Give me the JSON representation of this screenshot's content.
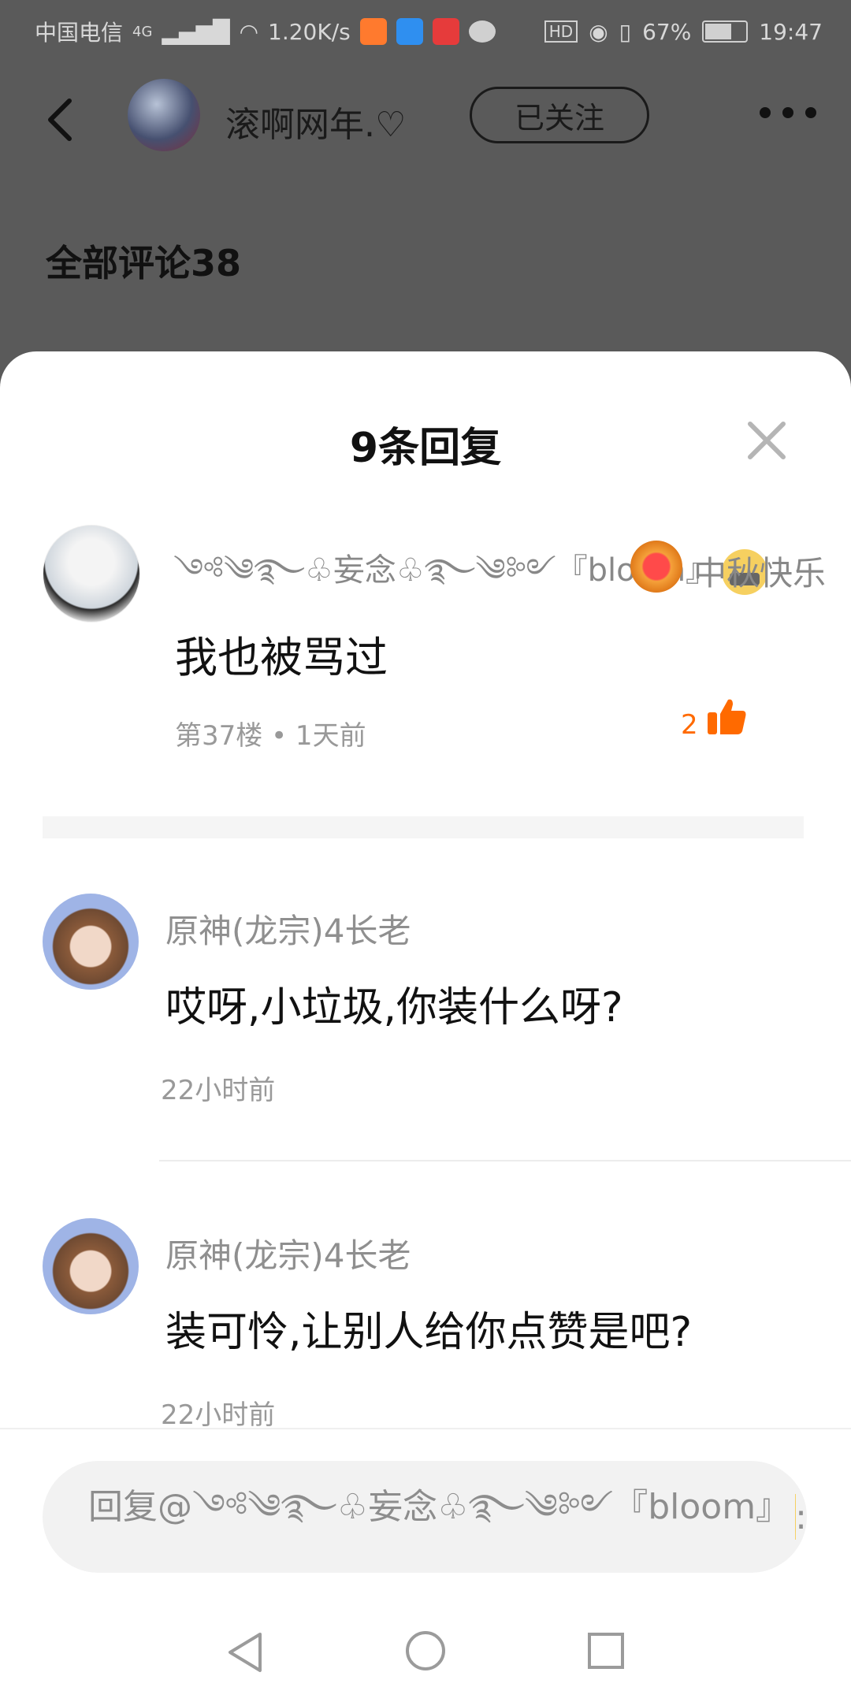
{
  "status_bar": {
    "carrier": "中国电信",
    "network": "4G",
    "speed": "1.20K/s",
    "hd": "HD",
    "battery": "67%",
    "time": "19:47"
  },
  "top_bar": {
    "username": "滚啊网年.♡",
    "follow_label": "已关注"
  },
  "all_comments_label": "全部评论38",
  "sheet": {
    "title": "9条回复",
    "main_comment": {
      "name": "༺༄࿐♧妄念♧࿐༄༻『bloom』",
      "badge_text": "中秋快乐",
      "text": "我也被骂过",
      "meta": "第37楼 • 1天前",
      "likes": "2"
    },
    "replies": [
      {
        "name": "原神(龙宗)4长老",
        "text": "哎呀,小垃圾,你装什么呀?",
        "time": "22小时前"
      },
      {
        "name": "原神(龙宗)4长老",
        "text": "装可怜,让别人给你点赞是吧?",
        "time": "22小时前"
      }
    ],
    "reply_placeholder": "回复@༺༄࿐♧妄念♧࿐༄༻『bloom』"
  }
}
